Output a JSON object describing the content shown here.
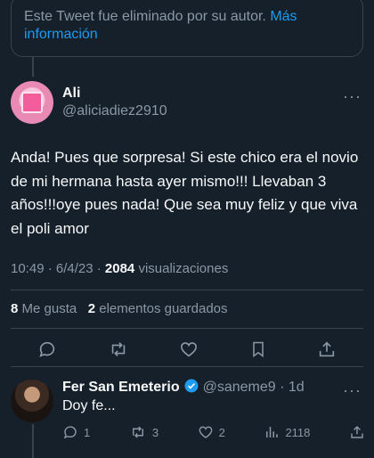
{
  "deleted_notice": {
    "text": "Este Tweet fue eliminado por su autor.",
    "link": "Más información"
  },
  "tweet": {
    "name": "Ali",
    "handle": "@aliciadiez2910",
    "text": "Anda! Pues que sorpresa! Si este chico era el novio de mi hermana hasta ayer mismo!!! Llevaban 3 años!!!oye pues nada! Que sea muy feliz y que viva el poli amor",
    "time": "10:49 · 6/4/23 ·",
    "views_count": "2084",
    "views_label": "visualizaciones",
    "likes_count": "8",
    "likes_label": "Me gusta",
    "bookmarks_count": "2",
    "bookmarks_label": "elementos guardados"
  },
  "reply": {
    "name": "Fer San Emeterio",
    "meta": "@saneme9 · 1d",
    "text": "Doy fe...",
    "replies": "1",
    "retweets": "3",
    "likes": "2",
    "views": "2118"
  },
  "more_label": "···",
  "colors": {
    "background": "#15202b",
    "accent": "#1d9bf0",
    "muted": "#8b98a5",
    "divider": "#38444d"
  }
}
